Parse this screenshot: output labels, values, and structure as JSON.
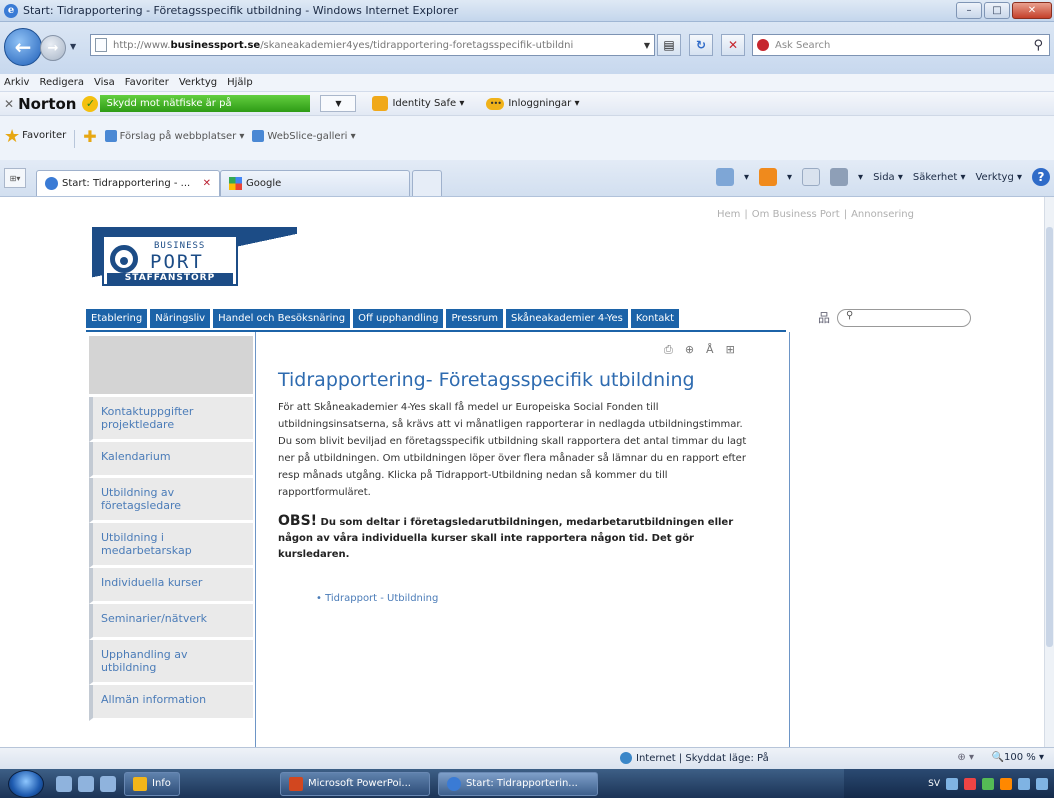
{
  "window": {
    "title": "Start: Tidrapportering - Företagsspecifik utbildning - Windows Internet Explorer"
  },
  "addressbar": {
    "url_prefix": "http://www.",
    "url_domain": "businessport.se",
    "url_path": "/skaneakademier4yes/tidrapportering-foretagsspecifik-utbildni",
    "search_placeholder": "Ask Search"
  },
  "menubar": [
    "Arkiv",
    "Redigera",
    "Visa",
    "Favoriter",
    "Verktyg",
    "Hjälp"
  ],
  "norton": {
    "brand": "Norton",
    "safe_label": "Skydd mot nätfiske är på",
    "identity_label": "Identity Safe ▾",
    "logins_label": "Inloggningar ▾"
  },
  "favorites": {
    "label": "Favoriter",
    "suggested": "Förslag på webbplatser ▾",
    "webslice": "WebSlice-galleri ▾"
  },
  "tabs": [
    {
      "label": "Start: Tidrapportering - ...",
      "active": true
    },
    {
      "label": "Google",
      "active": false
    }
  ],
  "commandbar": {
    "page": "Sida ▾",
    "safety": "Säkerhet ▾",
    "tools": "Verktyg ▾"
  },
  "site": {
    "toplinks": [
      "Hem",
      "Om Business Port",
      "Annonsering"
    ],
    "logo": {
      "business": "BUSINESS",
      "port": "PORT",
      "town": "STAFFANSTORP"
    },
    "nav": [
      "Etablering",
      "Näringsliv",
      "Handel och Besöksnäring",
      "Off upphandling",
      "Pressrum",
      "Skåneakademier 4-Yes",
      "Kontakt"
    ],
    "sidebar": [
      "Kontaktuppgifter projektledare",
      "Kalendarium",
      "Utbildning av företagsledare",
      "Utbildning i medarbetarskap",
      "Individuella kurser",
      "Seminarier/nätverk",
      "Upphandling av utbildning",
      "Allmän information"
    ],
    "page_tools": [
      "⎙",
      "⊕",
      "Å",
      "⊞"
    ]
  },
  "article": {
    "title": "Tidrapportering- Företagsspecifik utbildning",
    "p1": "För att Skåneakademier 4-Yes skall få medel ur Europeiska Social Fonden till utbildningsinsatserna, så krävs att vi månatligen rapporterar in nedlagda utbildningstimmar.",
    "p2": "Du som blivit beviljad en företagsspecifik utbildning skall rapportera det antal timmar du lagt ner på utbildningen. Om utbildningen löper över flera månader så lämnar du en rapport efter resp månads utgång. Klicka på Tidrapport-Utbildning nedan så kommer du till rapportformuläret.",
    "obs_lead": "OBS!",
    "obs_text": " Du som deltar i företagsledarutbildningen, medarbetarutbildningen eller någon av våra individuella kurser skall inte rapportera någon tid. Det gör kursledaren.",
    "link": "Tidrapport - Utbildning"
  },
  "statusbar": {
    "zone": "Internet | Skyddat läge: På",
    "zoom": "100 %"
  },
  "taskbar": {
    "items": [
      "Info",
      "Microsoft PowerPoi...",
      "Start: Tidrapporterin..."
    ],
    "tray_lang": "SV"
  }
}
